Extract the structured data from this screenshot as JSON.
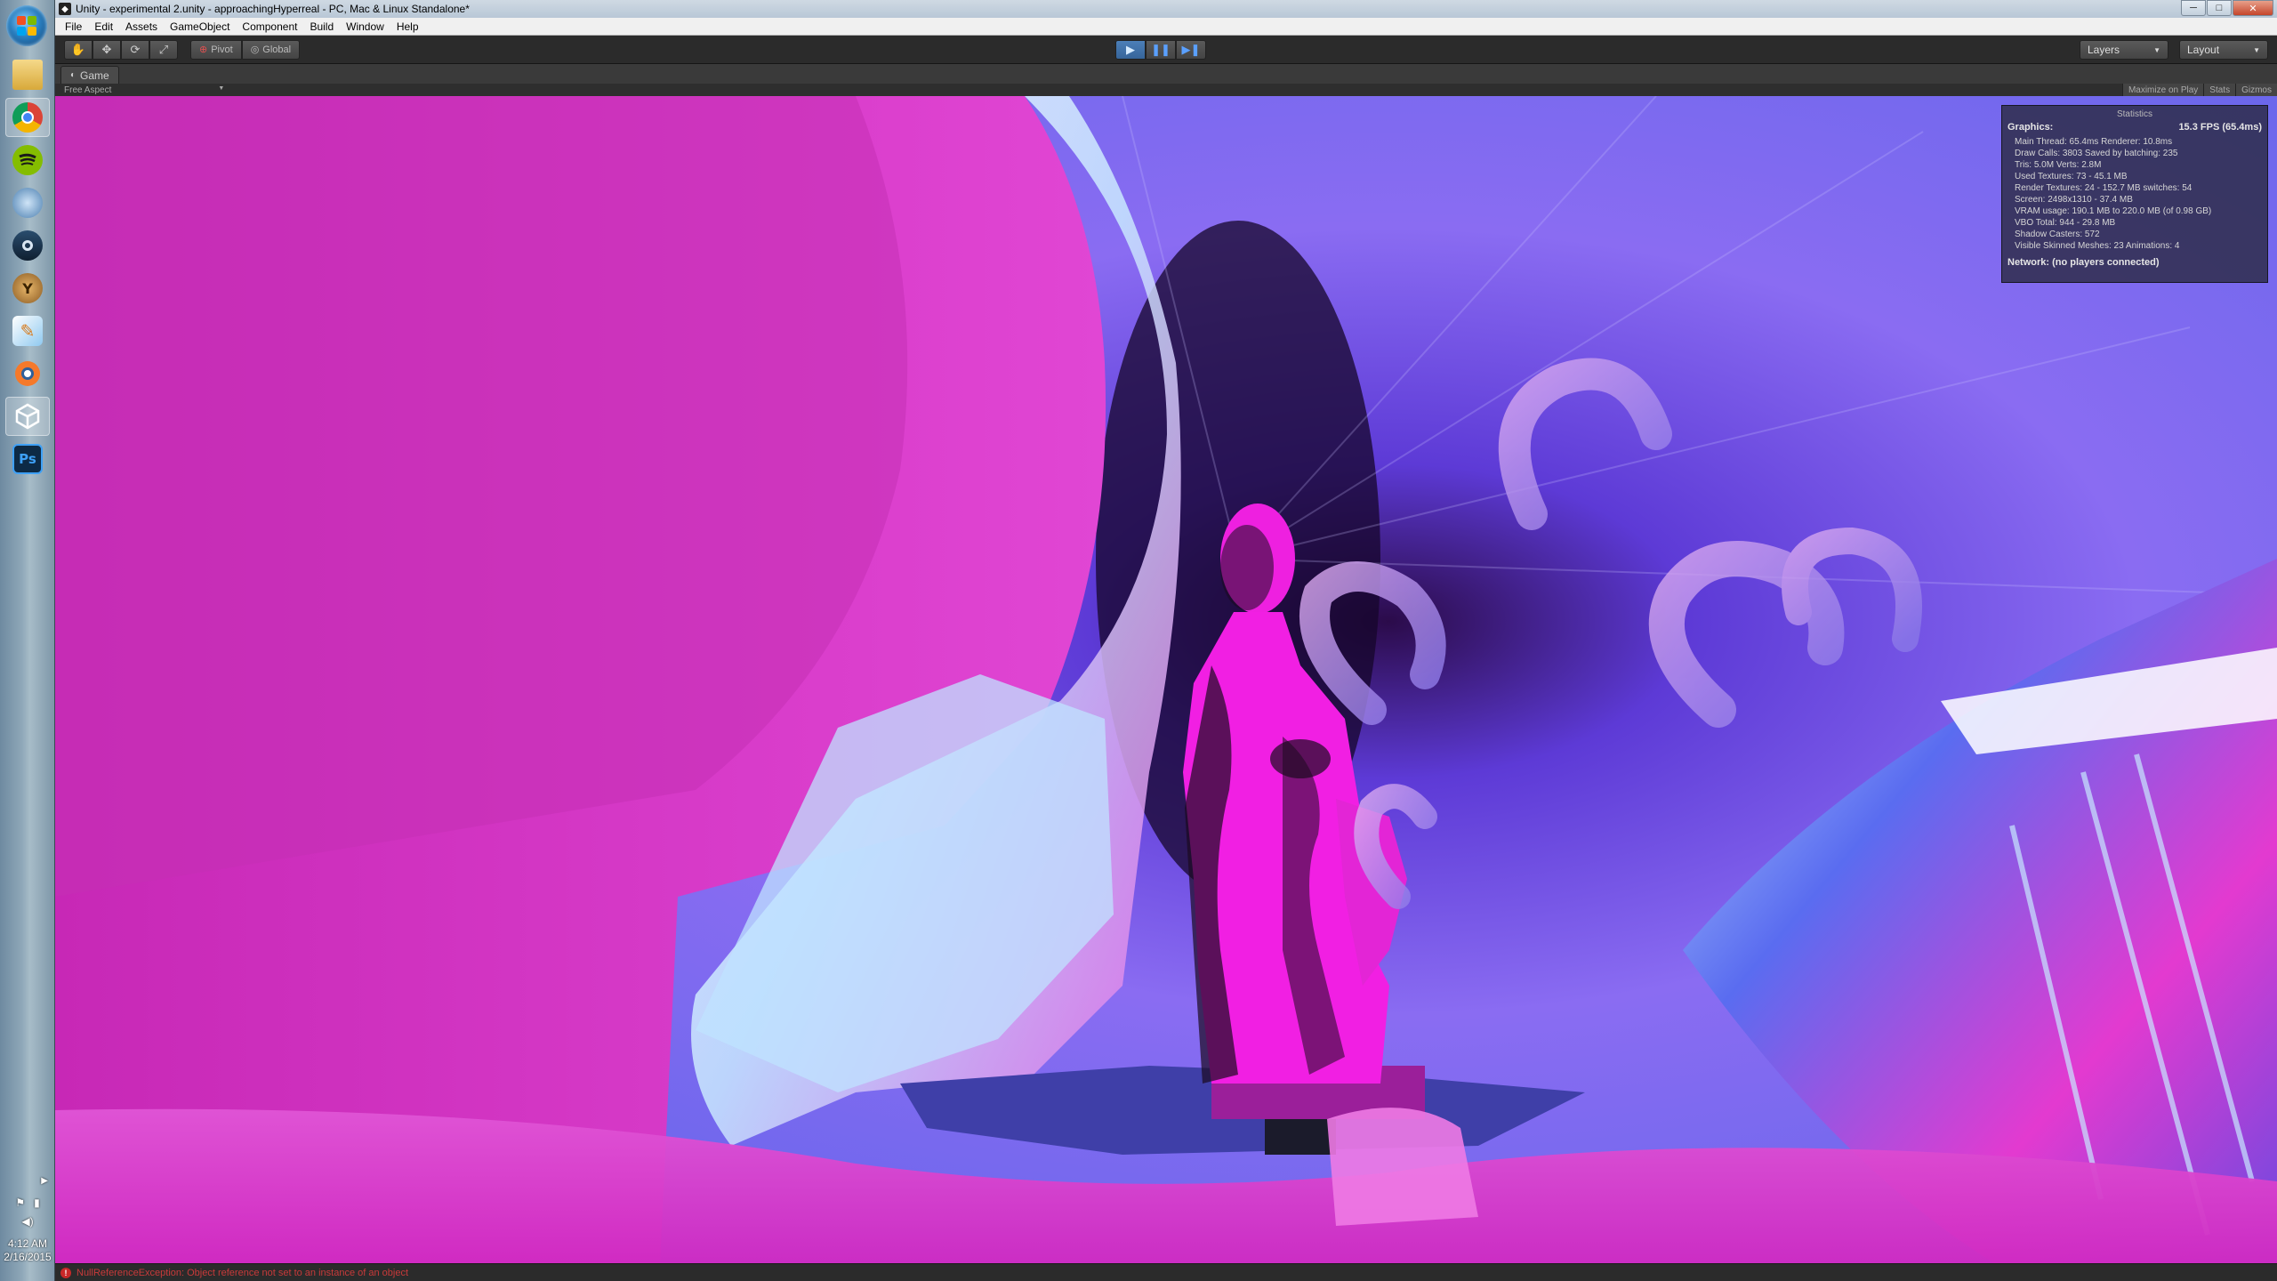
{
  "window": {
    "title": "Unity - experimental 2.unity - approachingHyperreal - PC, Mac & Linux Standalone*",
    "controls": {
      "minimize": "─",
      "maximize": "□",
      "close": "✕"
    }
  },
  "menu": [
    "File",
    "Edit",
    "Assets",
    "GameObject",
    "Component",
    "Build",
    "Window",
    "Help"
  ],
  "toolbar": {
    "pivot_label": "Pivot",
    "global_label": "Global",
    "layers_label": "Layers",
    "layout_label": "Layout"
  },
  "game_view": {
    "tab_label": "Game",
    "aspect_label": "Free Aspect",
    "maximize_label": "Maximize on Play",
    "stats_label": "Stats",
    "gizmos_label": "Gizmos"
  },
  "stats": {
    "header": "Statistics",
    "graphics_label": "Graphics:",
    "fps": "15.3 FPS (65.4ms)",
    "lines": [
      "Main Thread: 65.4ms  Renderer: 10.8ms",
      "Draw Calls: 3803  Saved by batching: 235",
      "Tris: 5.0M    Verts: 2.8M",
      "Used Textures: 73 - 45.1 MB",
      "Render Textures: 24 - 152.7 MB    switches: 54",
      "Screen: 2498x1310 - 37.4 MB",
      "VRAM usage: 190.1 MB to 220.0 MB (of 0.98 GB)",
      "VBO Total: 944 - 29.8 MB",
      "Shadow Casters: 572",
      "Visible Skinned Meshes: 23    Animations: 4"
    ],
    "network": "Network: (no players connected)"
  },
  "status": {
    "message": "NullReferenceException: Object reference not set to an instance of an object"
  },
  "taskbar": {
    "apps": [
      "file-explorer",
      "chrome",
      "spotify",
      "network-tool",
      "steam",
      "app-y",
      "sketch-app",
      "blender",
      "unity",
      "photoshop"
    ],
    "photoshop_label": "Ps",
    "clock_time": "4:12 AM",
    "clock_date": "2/16/2015"
  },
  "colors": {
    "accent": "#3e6fa8",
    "scene_magenta": "#d836c8",
    "scene_blue": "#6a5cf0",
    "error": "#c83a3a"
  }
}
